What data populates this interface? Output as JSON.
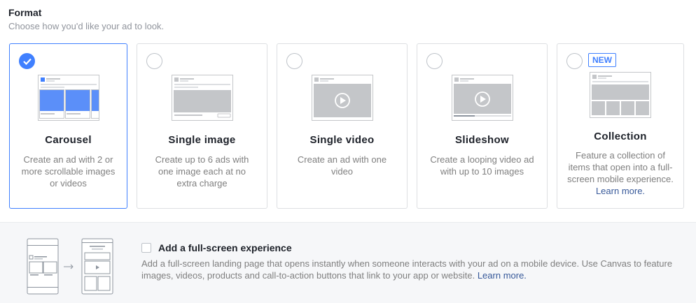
{
  "header": {
    "title": "Format",
    "subtitle": "Choose how you'd like your ad to look."
  },
  "colors": {
    "accent": "#4080ff",
    "link": "#365899",
    "muted_text": "#7f7f7f",
    "placeholder_gray": "#c4c6c9"
  },
  "formats": [
    {
      "title": "Carousel",
      "description": "Create an ad with 2 or more scrollable images or videos",
      "selected": true,
      "icon": "carousel-preview-icon"
    },
    {
      "title": "Single image",
      "description": "Create up to 6 ads with one image each at no extra charge",
      "selected": false,
      "icon": "single-image-preview-icon"
    },
    {
      "title": "Single video",
      "description": "Create an ad with one video",
      "selected": false,
      "icon": "single-video-preview-icon"
    },
    {
      "title": "Slideshow",
      "description": "Create a looping video ad with up to 10 images",
      "selected": false,
      "icon": "slideshow-preview-icon"
    },
    {
      "title": "Collection",
      "badge": "NEW",
      "description": "Feature a collection of items that open into a full-screen mobile experience.",
      "link": "Learn more.",
      "selected": false,
      "icon": "collection-preview-icon"
    }
  ],
  "fullscreen": {
    "title": "Add a full-screen experience",
    "description": "Add a full-screen landing page that opens instantly when someone interacts with your ad on a mobile device. Use Canvas to feature images, videos, products and call-to-action buttons that link to your app or website.",
    "link": "Learn more.",
    "checked": false,
    "icon": "canvas-preview-icon"
  }
}
